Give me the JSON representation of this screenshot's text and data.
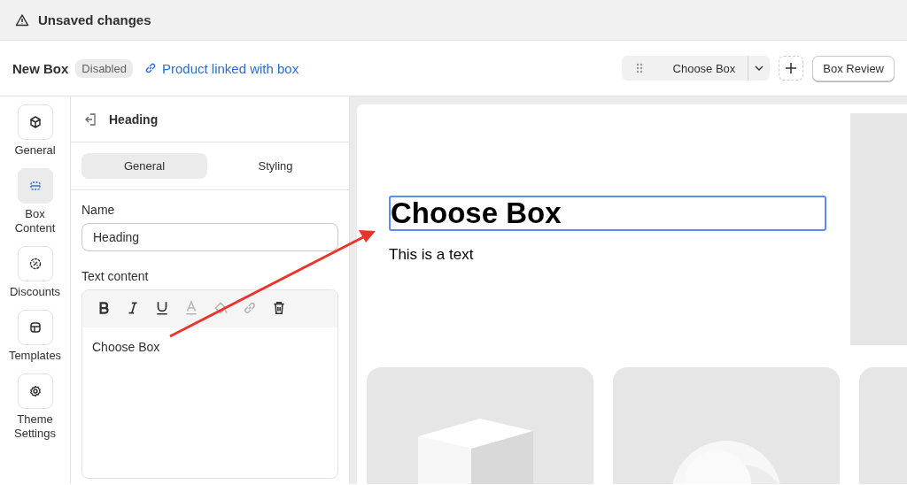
{
  "banner": {
    "text": "Unsaved changes"
  },
  "header": {
    "title": "New Box",
    "status": "Disabled",
    "link": "Product linked with box",
    "page_select": "Choose Box",
    "review_button": "Box Review"
  },
  "sidebar": {
    "items": [
      {
        "label": "General",
        "selected": false
      },
      {
        "label": "Box Content",
        "selected": true
      },
      {
        "label": "Discounts",
        "selected": false
      },
      {
        "label": "Templates",
        "selected": false
      },
      {
        "label": "Theme Settings",
        "selected": false
      }
    ]
  },
  "panel": {
    "title": "Heading",
    "tabs": [
      {
        "label": "General",
        "selected": true
      },
      {
        "label": "Styling",
        "selected": false
      }
    ],
    "name_label": "Name",
    "name_value": "Heading",
    "content_label": "Text content",
    "tools": [
      {
        "kind": "bold",
        "disabled": false
      },
      {
        "kind": "italic",
        "disabled": false
      },
      {
        "kind": "underline",
        "disabled": false
      },
      {
        "kind": "color",
        "disabled": true
      },
      {
        "kind": "fill",
        "disabled": true
      },
      {
        "kind": "link",
        "disabled": true
      },
      {
        "kind": "delete",
        "disabled": false
      }
    ],
    "content_value": "Choose Box"
  },
  "preview": {
    "heading": "Choose Box",
    "text": "This is a text"
  }
}
